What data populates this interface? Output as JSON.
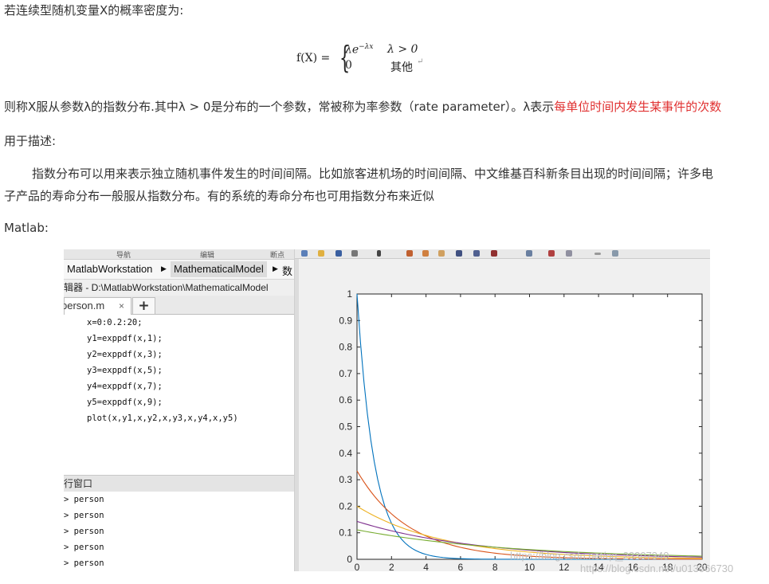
{
  "article": {
    "intro": "若连续型随机变量X的概率密度为:",
    "formula": {
      "lhs": "f(X) =",
      "case1_expr": "λe",
      "case1_exp": "−λx",
      "case1_cond": "λ > 0",
      "case2_expr": "0",
      "case2_cond": "其他",
      "return_mark": "↵"
    },
    "def_prefix": "则称X服从参数λ的指数分布.其中λ > 0是分布的一个参数，常被称为率参数（rate parameter）。λ表示",
    "def_highlight": "每单位时间内发生某事件的次数",
    "usage_label": "用于描述:",
    "usage_line1": "指数分布可以用来表示独立随机事件发生的时间间隔。比如旅客进机场的时间间隔、中文维基百科新条目出现的时间间隔；许多电",
    "usage_line2": "子产品的寿命分布一般服从指数分布。有的系统的寿命分布也可用指数分布来近似",
    "matlab_label": "Matlab:",
    "highlight_color": "#e03030"
  },
  "matlab": {
    "top_tabs": [
      "导航",
      "编辑",
      "断点"
    ],
    "path": [
      "MatlabWorkstation",
      "MathematicalModel",
      "数"
    ],
    "editor_title": "辑器 - D:\\MatlabWorkstation\\MathematicalModel",
    "file_tab": "person.m",
    "close_glyph": "×",
    "add_glyph": "+",
    "code": [
      "x=0:0.2:20;",
      "y1=exppdf(x,1);",
      "y2=exppdf(x,3);",
      "y3=exppdf(x,5);",
      "y4=exppdf(x,7);",
      "y5=exppdf(x,9);",
      "plot(x,y1,x,y2,x,y3,x,y4,x,y5)"
    ],
    "command_window_title": "行窗口",
    "command_history": [
      "> person",
      "> person",
      "> person",
      "> person",
      "> person"
    ]
  },
  "chart_data": {
    "type": "line",
    "title": "",
    "xlabel": "",
    "ylabel": "",
    "xlim": [
      0,
      20
    ],
    "ylim": [
      0,
      1
    ],
    "xticks": [
      0,
      2,
      4,
      6,
      8,
      10,
      12,
      14,
      16,
      18,
      20
    ],
    "yticks": [
      0,
      0.1,
      0.2,
      0.3,
      0.4,
      0.5,
      0.6,
      0.7,
      0.8,
      0.9,
      1
    ],
    "grid": false,
    "x_step": 0.2,
    "series": [
      {
        "mu": 1,
        "color": "#0072BD"
      },
      {
        "mu": 3,
        "color": "#D95319"
      },
      {
        "mu": 5,
        "color": "#EDB120"
      },
      {
        "mu": 7,
        "color": "#7E2F8E"
      },
      {
        "mu": 9,
        "color": "#77AC30"
      }
    ]
  },
  "watermarks": [
    "https://blog.csdn.net/qq_23307340",
    "https://blog.csdn.net/u013066730"
  ]
}
